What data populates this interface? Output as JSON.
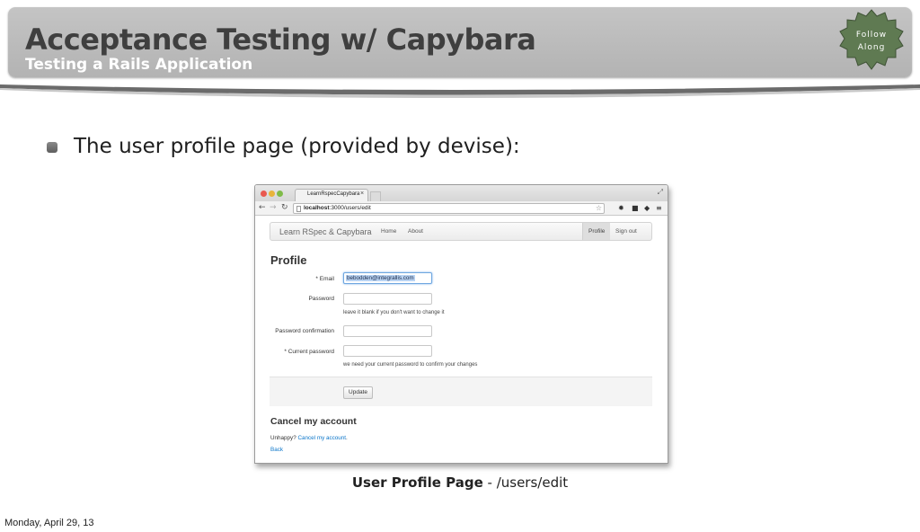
{
  "header": {
    "title": "Acceptance Testing w/ Capybara",
    "subtitle": "Testing a Rails Application",
    "badge_line1": "Follow",
    "badge_line2": "Along",
    "badge_color": "#5f7a52"
  },
  "bullet": {
    "text": "The user profile page (provided by devise):"
  },
  "browser": {
    "tab_title": "LearnRspecCapybara",
    "tab_close": "×",
    "url_host": "localhost",
    "url_path": ":3000/users/edit",
    "icons": [
      "back-icon",
      "forward-icon",
      "reload-icon",
      "star-icon",
      "gear-icon",
      "extension-icon",
      "share-icon",
      "menu-icon"
    ],
    "nav": {
      "brand": "Learn RSpec & Capybara",
      "links": [
        "Home",
        "About"
      ],
      "right_links": [
        "Profile",
        "Sign out"
      ]
    },
    "form": {
      "heading": "Profile",
      "email_label": "* Email",
      "email_value": "bebodden@integrallis.com",
      "password_label": "Password",
      "password_hint": "leave it blank if you don't want to change it",
      "confirm_label": "Password confirmation",
      "current_label": "* Current password",
      "current_hint": "we need your current password to confirm your changes",
      "submit": "Update"
    },
    "cancel": {
      "heading": "Cancel my account",
      "prefix": "Unhappy?",
      "link": "Cancel my account",
      "suffix": ".",
      "back": "Back"
    }
  },
  "caption": {
    "bold": "User Profile Page",
    "rest": " - /users/edit"
  },
  "footer": {
    "date": "Monday, April 29, 13"
  }
}
